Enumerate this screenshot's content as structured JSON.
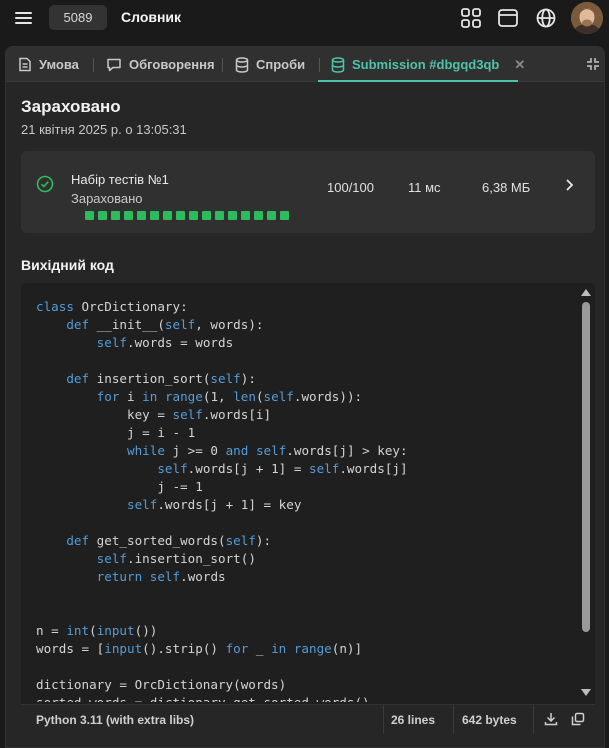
{
  "header": {
    "problem_id": "5089",
    "problem_title": "Словник"
  },
  "tabs": [
    {
      "label": "Умова",
      "icon": "document-icon"
    },
    {
      "label": "Обговорення",
      "icon": "chat-bubble-icon"
    },
    {
      "label": "Спроби",
      "icon": "database-icon"
    },
    {
      "label": "Submission #dbgqd3qb",
      "icon": "database-icon",
      "active": true
    }
  ],
  "submission": {
    "status": "Зараховано",
    "date": "21 квітня 2025 р. о 13:05:31"
  },
  "test_set": {
    "name": "Набір тестів №1",
    "status": "Зараховано",
    "score": "100/100",
    "time": "11 мс",
    "memory": "6,38 МБ",
    "passed_tests": 16,
    "status_color": "#2cbb5d"
  },
  "source": {
    "heading": "Вихідний код",
    "language": "Python 3.11 (with extra libs)",
    "lines": "26 lines",
    "bytes": "642 bytes",
    "code_lines": [
      "class OrcDictionary:",
      "    def __init__(self, words):",
      "        self.words = words",
      "",
      "    def insertion_sort(self):",
      "        for i in range(1, len(self.words)):",
      "            key = self.words[i]",
      "            j = i - 1",
      "            while j >= 0 and self.words[j] > key:",
      "                self.words[j + 1] = self.words[j]",
      "                j -= 1",
      "            self.words[j + 1] = key",
      "",
      "    def get_sorted_words(self):",
      "        self.insertion_sort()",
      "        return self.words",
      "",
      "",
      "n = int(input())",
      "words = [input().strip() for _ in range(n)]",
      "",
      "dictionary = OrcDictionary(words)",
      "sorted_words = dictionary.get_sorted_words()"
    ]
  },
  "colors": {
    "accent": "#4fc3a9",
    "success": "#2cbb5d",
    "keyword": "#569cd6"
  }
}
